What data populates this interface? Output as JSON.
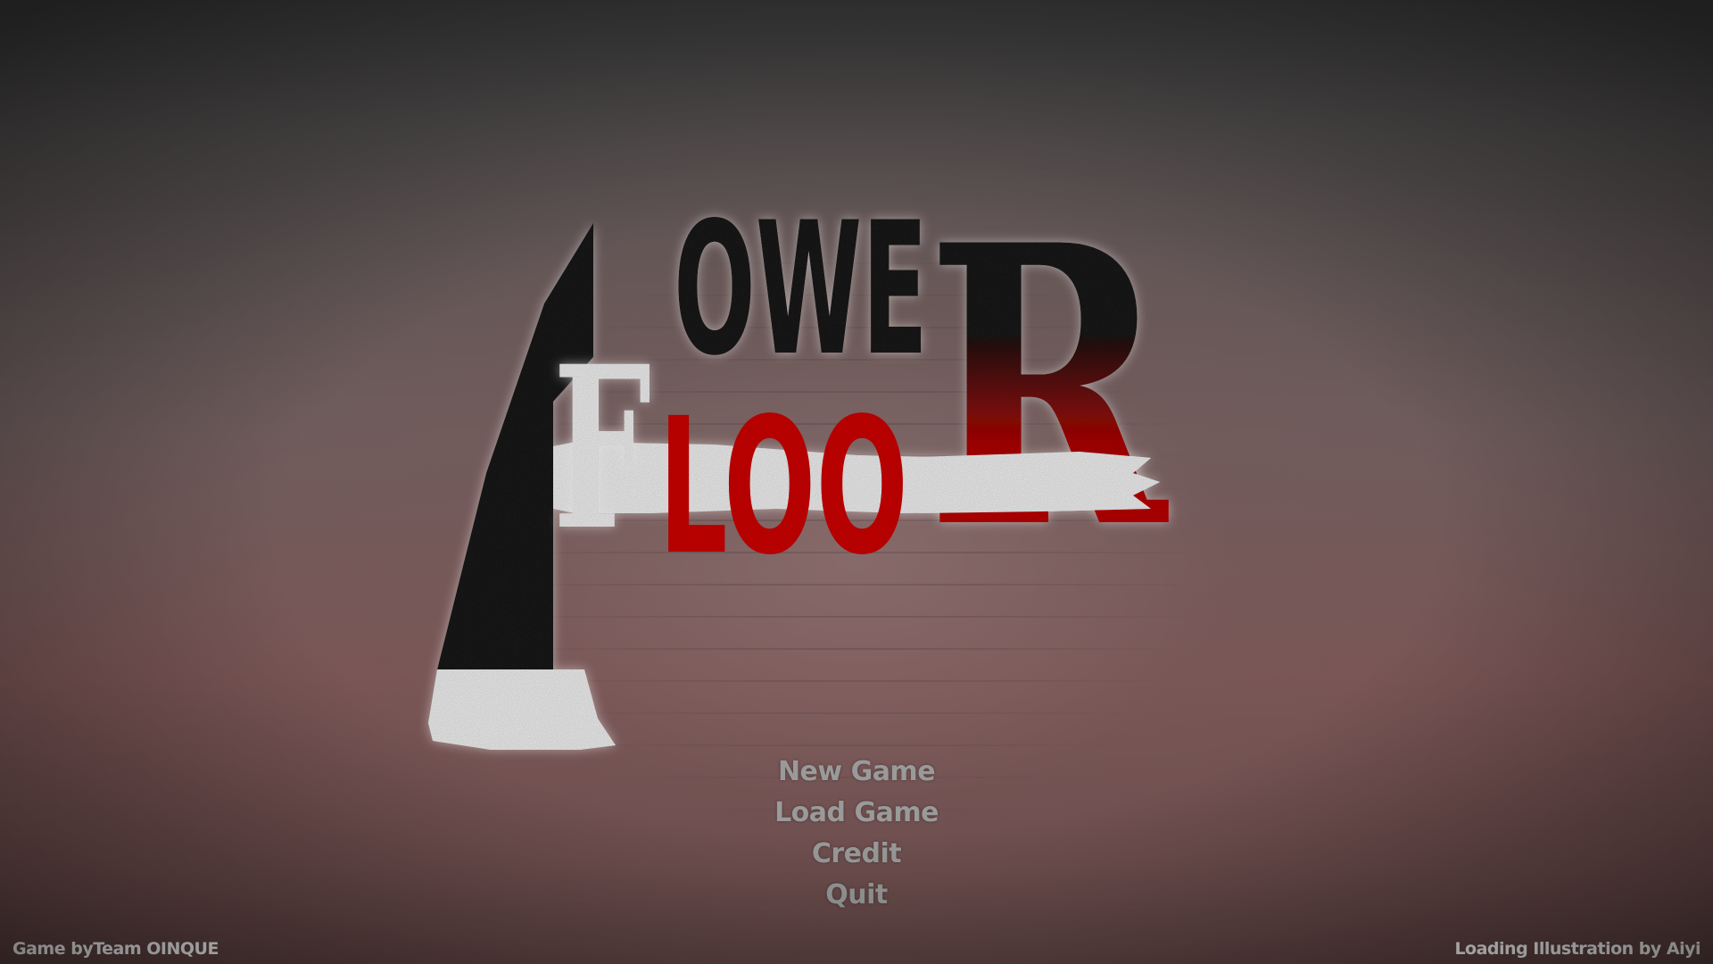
{
  "logo": {
    "word_top": "OWE",
    "word_bottom": "LOO",
    "letter_f": "F",
    "letter_r": "R",
    "colors": {
      "black": "#1c1c1c",
      "red": "#d20f10",
      "white": "#f5f5f5"
    }
  },
  "menu": {
    "items": [
      {
        "label": "New Game"
      },
      {
        "label": "Load Game"
      },
      {
        "label": "Credit"
      },
      {
        "label": "Quit"
      }
    ]
  },
  "footer": {
    "left": "Game byTeam OINQUE",
    "right": "Loading Illustration by Aiyi"
  }
}
